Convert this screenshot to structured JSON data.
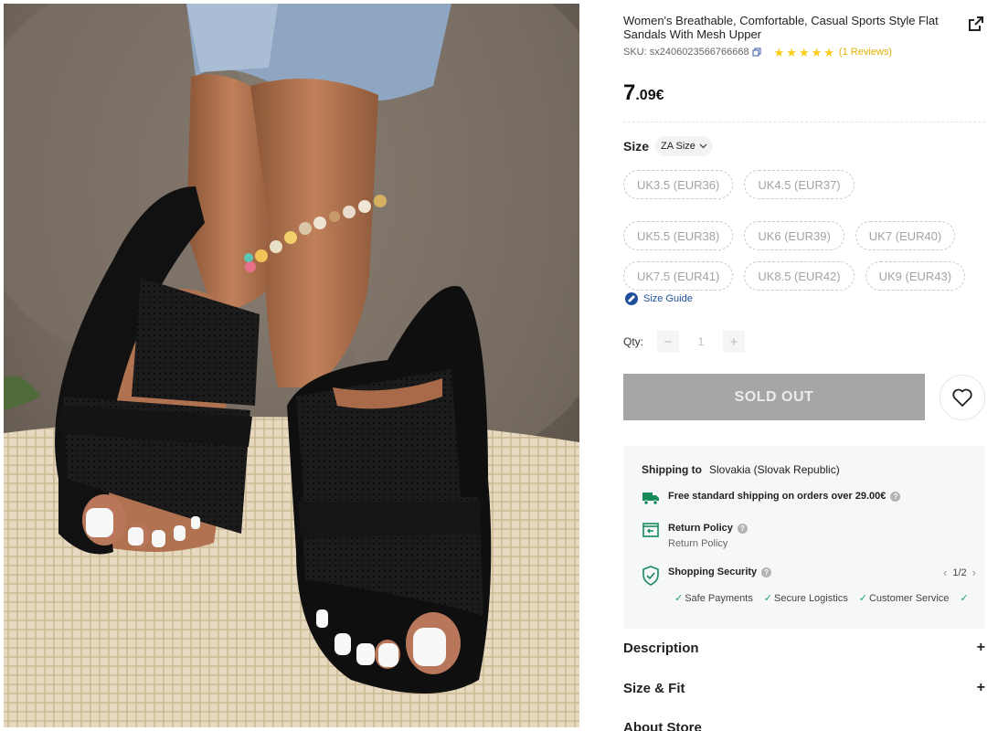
{
  "product": {
    "title": "Women's Breathable, Comfortable, Casual Sports Style Flat Sandals With Mesh Upper",
    "sku_label": "SKU:",
    "sku": "sx2406023566766668",
    "rating_stars": 5,
    "reviews": "(1 Reviews)",
    "price_int": "7",
    "price_dec": ".09€"
  },
  "size": {
    "label": "Size",
    "selector": "ZA Size",
    "options": [
      "UK3.5 (EUR36)",
      "UK4.5 (EUR37)",
      "UK5.5 (EUR38)",
      "UK6 (EUR39)",
      "UK7 (EUR40)",
      "UK7.5 (EUR41)",
      "UK8.5 (EUR42)",
      "UK9 (EUR43)"
    ],
    "guide": "Size Guide"
  },
  "qty": {
    "label": "Qty:",
    "minus": "−",
    "value": "1",
    "plus": "+"
  },
  "buttons": {
    "soldout": "SOLD OUT"
  },
  "shipping": {
    "to_label": "Shipping to",
    "country": "Slovakia (Slovak Republic)",
    "free": "Free standard shipping on orders over 29.00€",
    "return_title": "Return Policy",
    "return_sub": "Return Policy",
    "security_title": "Shopping Security",
    "pager": "1/2",
    "tags": [
      "Safe Payments",
      "Secure Logistics",
      "Customer Service"
    ]
  },
  "accordion": {
    "description": "Description",
    "size_fit": "Size & Fit",
    "about": "About Store"
  },
  "colors": {
    "star": "#facc15",
    "link": "#1f4f9a",
    "green": "#22a06b",
    "soldout": "#a6a6a6"
  },
  "icons": [
    "share-icon",
    "copy-icon",
    "star-icon",
    "chevron-down-icon",
    "size-guide-icon",
    "heart-icon",
    "truck-icon",
    "return-icon",
    "shield-icon",
    "help-icon",
    "check-icon",
    "plus-icon"
  ]
}
